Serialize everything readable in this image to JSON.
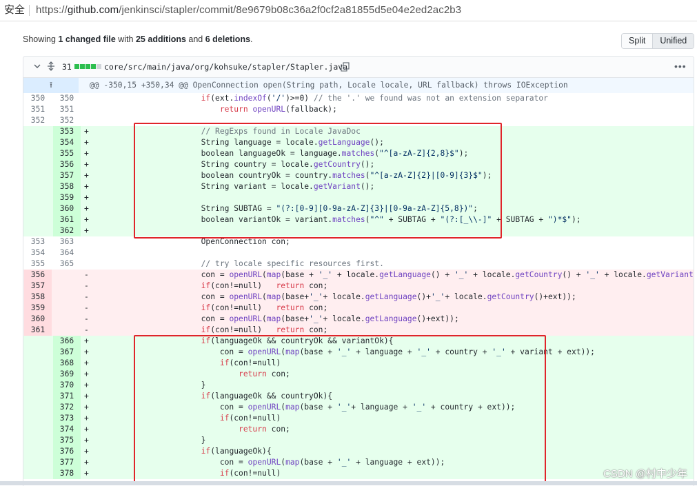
{
  "browser": {
    "secure_label": "安全",
    "url_prefix": "https://",
    "url_host": "github.com",
    "url_path": "/jenkinsci/stapler/commit/8e9679b08c36a2f0cf2a81855d5e04e2ed2ac2b3"
  },
  "summary": {
    "prefix": "Showing ",
    "files": "1 changed file",
    "mid1": " with ",
    "additions": "25 additions",
    "mid2": " and ",
    "deletions": "6 deletions",
    "suffix": "."
  },
  "view_toggle": {
    "split": "Split",
    "unified": "Unified"
  },
  "file": {
    "change_count": "31",
    "path": "core/src/main/java/org/kohsuke/stapler/Stapler.java",
    "colors": {
      "added": "#2cbe4e",
      "removed": "#cb2431",
      "neutral": "#d1d5da"
    },
    "stat_blocks": [
      "added",
      "added",
      "added",
      "added",
      "neutral"
    ],
    "icons": {
      "collapse": "chevron-down-icon",
      "unfold": "unfold-icon",
      "copy": "copy-icon",
      "menu": "kebab-horizontal-icon"
    }
  },
  "hunk_header": "@@ -350,15 +350,34 @@ OpenConnection open(String path, Locale locale, URL fallback) throws IOException",
  "lines": [
    {
      "t": "ctx",
      "o": "350",
      "n": "350",
      "code": "            if(ext.indexOf('/')>=0) // the '.' we found was not an extension separator"
    },
    {
      "t": "ctx",
      "o": "351",
      "n": "351",
      "code": "                return openURL(fallback);"
    },
    {
      "t": "ctx",
      "o": "352",
      "n": "352",
      "code": ""
    },
    {
      "t": "add",
      "o": "",
      "n": "353",
      "code": "            // RegExps found in Locale JavaDoc"
    },
    {
      "t": "add",
      "o": "",
      "n": "354",
      "code": "            String language = locale.getLanguage();"
    },
    {
      "t": "add",
      "o": "",
      "n": "355",
      "code": "            boolean languageOk = language.matches(\"^[a-zA-Z]{2,8}$\");"
    },
    {
      "t": "add",
      "o": "",
      "n": "356",
      "code": "            String country = locale.getCountry();"
    },
    {
      "t": "add",
      "o": "",
      "n": "357",
      "code": "            boolean countryOk = country.matches(\"^[a-zA-Z]{2}|[0-9]{3}$\");"
    },
    {
      "t": "add",
      "o": "",
      "n": "358",
      "code": "            String variant = locale.getVariant();"
    },
    {
      "t": "add",
      "o": "",
      "n": "359",
      "code": ""
    },
    {
      "t": "add",
      "o": "",
      "n": "360",
      "code": "            String SUBTAG = \"(?:[0-9][0-9a-zA-Z]{3}|[0-9a-zA-Z]{5,8})\";"
    },
    {
      "t": "add",
      "o": "",
      "n": "361",
      "code": "            boolean variantOk = variant.matches(\"^\" + SUBTAG + \"(?:[_\\\\-]\" + SUBTAG + \")*$\");"
    },
    {
      "t": "add",
      "o": "",
      "n": "362",
      "code": ""
    },
    {
      "t": "ctx",
      "o": "353",
      "n": "363",
      "code": "            OpenConnection con;"
    },
    {
      "t": "ctx",
      "o": "354",
      "n": "364",
      "code": ""
    },
    {
      "t": "ctx",
      "o": "355",
      "n": "365",
      "code": "            // try locale specific resources first."
    },
    {
      "t": "del",
      "o": "356",
      "n": "",
      "code": "            con = openURL(map(base + '_' + locale.getLanguage() + '_' + locale.getCountry() + '_' + locale.getVariant() + ext));"
    },
    {
      "t": "del",
      "o": "357",
      "n": "",
      "code": "            if(con!=null)   return con;"
    },
    {
      "t": "del",
      "o": "358",
      "n": "",
      "code": "            con = openURL(map(base+'_'+ locale.getLanguage()+'_'+ locale.getCountry()+ext));"
    },
    {
      "t": "del",
      "o": "359",
      "n": "",
      "code": "            if(con!=null)   return con;"
    },
    {
      "t": "del",
      "o": "360",
      "n": "",
      "code": "            con = openURL(map(base+'_'+ locale.getLanguage()+ext));"
    },
    {
      "t": "del",
      "o": "361",
      "n": "",
      "code": "            if(con!=null)   return con;"
    },
    {
      "t": "add",
      "o": "",
      "n": "366",
      "code": "            if(languageOk && countryOk && variantOk){"
    },
    {
      "t": "add",
      "o": "",
      "n": "367",
      "code": "                con = openURL(map(base + '_' + language + '_' + country + '_' + variant + ext));"
    },
    {
      "t": "add",
      "o": "",
      "n": "368",
      "code": "                if(con!=null)"
    },
    {
      "t": "add",
      "o": "",
      "n": "369",
      "code": "                    return con;"
    },
    {
      "t": "add",
      "o": "",
      "n": "370",
      "code": "            }"
    },
    {
      "t": "add",
      "o": "",
      "n": "371",
      "code": "            if(languageOk && countryOk){"
    },
    {
      "t": "add",
      "o": "",
      "n": "372",
      "code": "                con = openURL(map(base + '_'+ language + '_' + country + ext));"
    },
    {
      "t": "add",
      "o": "",
      "n": "373",
      "code": "                if(con!=null)"
    },
    {
      "t": "add",
      "o": "",
      "n": "374",
      "code": "                    return con;"
    },
    {
      "t": "add",
      "o": "",
      "n": "375",
      "code": "            }"
    },
    {
      "t": "add",
      "o": "",
      "n": "376",
      "code": "            if(languageOk){"
    },
    {
      "t": "add",
      "o": "",
      "n": "377",
      "code": "                con = openURL(map(base + '_' + language + ext));"
    },
    {
      "t": "add",
      "o": "",
      "n": "378",
      "code": "                if(con!=null)"
    }
  ],
  "watermark": "CSDN @村中少年"
}
